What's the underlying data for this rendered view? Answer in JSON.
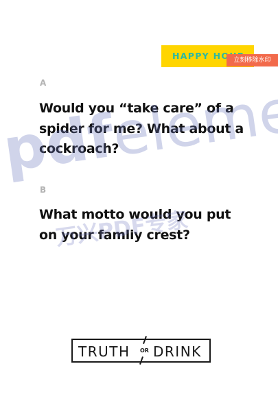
{
  "tag": {
    "label": "HAPPY HOUR",
    "color": "#ffd500",
    "text_color": "#2bb8a3"
  },
  "watermark_button": {
    "label": "立刻移除水印",
    "color": "#f26a4b"
  },
  "questions": [
    {
      "letter": "A",
      "text": "Would you “take care” of a spider for me? What about a cockroach?"
    },
    {
      "letter": "B",
      "text": "What motto would you put on your famliy crest?"
    }
  ],
  "watermark": {
    "main_bold": "pdf",
    "main_light": "eleme",
    "sub": "万兴PDF专家"
  },
  "logo": {
    "left": "TRUTH",
    "or": "OR",
    "right": "DRINK"
  }
}
